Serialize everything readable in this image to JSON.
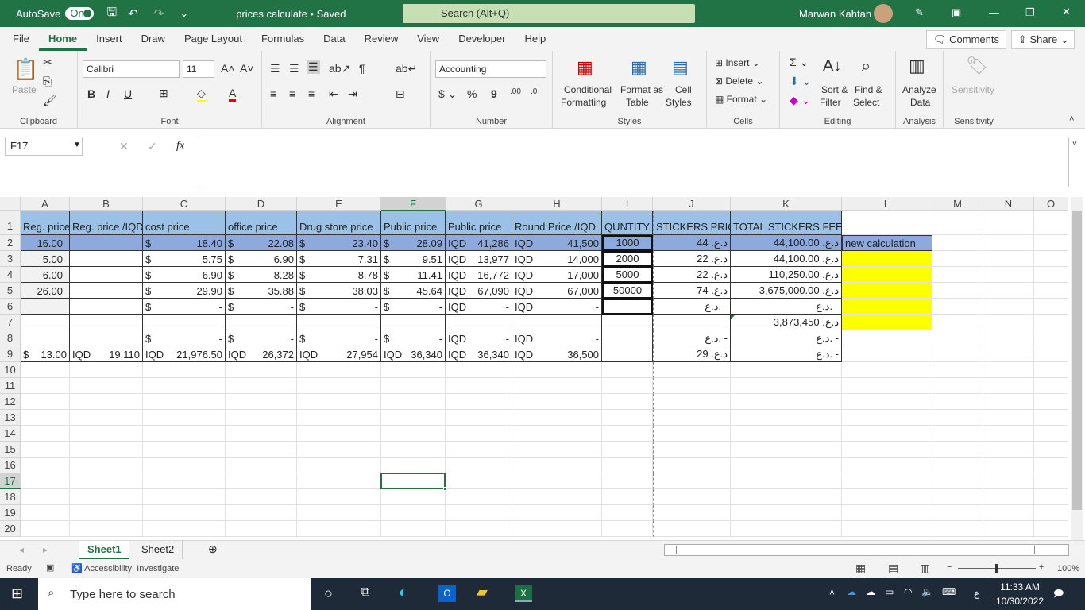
{
  "titlebar": {
    "autosave": "AutoSave",
    "toggle": "On",
    "doc_title": "prices calculate • Saved",
    "search": "Search (Alt+Q)",
    "user": "Marwan Kahtan"
  },
  "menu": {
    "tabs": [
      "File",
      "Home",
      "Insert",
      "Draw",
      "Page Layout",
      "Formulas",
      "Data",
      "Review",
      "View",
      "Developer",
      "Help"
    ],
    "active": "Home",
    "comments": "Comments",
    "share": "Share"
  },
  "ribbon": {
    "clipboard": {
      "label": "Clipboard",
      "paste": "Paste"
    },
    "font": {
      "label": "Font",
      "name": "Calibri",
      "size": "11"
    },
    "alignment": {
      "label": "Alignment"
    },
    "number": {
      "label": "Number",
      "format": "Accounting"
    },
    "styles": {
      "label": "Styles",
      "conditional": "Conditional",
      "formatting": "Formatting",
      "format_as": "Format as",
      "table": "Table",
      "cell": "Cell",
      "cell_styles": "Styles"
    },
    "cells": {
      "label": "Cells",
      "insert": "Insert",
      "delete": "Delete",
      "format": "Format"
    },
    "editing": {
      "label": "Editing",
      "sort": "Sort &",
      "filter": "Filter",
      "find": "Find &",
      "select": "Select"
    },
    "analysis": {
      "label": "Analysis",
      "analyze": "Analyze",
      "data": "Data"
    },
    "sensitivity": {
      "label": "Sensitivity",
      "btn": "Sensitivity"
    }
  },
  "formula_bar": {
    "name_box": "F17",
    "fx": "fx",
    "formula": ""
  },
  "sheet": {
    "columns": [
      "A",
      "B",
      "C",
      "D",
      "E",
      "F",
      "G",
      "H",
      "I",
      "J",
      "K",
      "L",
      "M",
      "N",
      "O"
    ],
    "selected_col": "F",
    "selected_row": 17,
    "row_count": 20,
    "rows": [
      [
        "Reg. price",
        "Reg. price /IQD",
        "cost price",
        "office price",
        "Drug store price",
        "Public price",
        "Public price",
        "Round Price /IQD",
        "QUNTITY",
        "STICKERS PRICE",
        "TOTAL STICKERS FEES",
        ""
      ],
      [
        "16.00",
        "",
        [
          "$",
          "18.40"
        ],
        [
          "$",
          "22.08"
        ],
        [
          "$",
          "23.40"
        ],
        [
          "$",
          "28.09"
        ],
        [
          "IQD",
          "41,286"
        ],
        [
          "IQD",
          "41,500"
        ],
        "1000",
        [
          "",
          "د.ع. 44"
        ],
        [
          "",
          "د.ع. 44,100.00"
        ],
        "new calculation"
      ],
      [
        "5.00",
        "",
        [
          "$",
          "5.75"
        ],
        [
          "$",
          "6.90"
        ],
        [
          "$",
          "7.31"
        ],
        [
          "$",
          "9.51"
        ],
        [
          "IQD",
          "13,977"
        ],
        [
          "IQD",
          "14,000"
        ],
        "2000",
        [
          "",
          "د.ع. 22"
        ],
        [
          "",
          "د.ع. 44,100.00"
        ],
        ""
      ],
      [
        "6.00",
        "",
        [
          "$",
          "6.90"
        ],
        [
          "$",
          "8.28"
        ],
        [
          "$",
          "8.78"
        ],
        [
          "$",
          "11.41"
        ],
        [
          "IQD",
          "16,772"
        ],
        [
          "IQD",
          "17,000"
        ],
        "5000",
        [
          "",
          "د.ع. 22"
        ],
        [
          "",
          "د.ع. 110,250.00"
        ],
        ""
      ],
      [
        "26.00",
        "",
        [
          "$",
          "29.90"
        ],
        [
          "$",
          "35.88"
        ],
        [
          "$",
          "38.03"
        ],
        [
          "$",
          "45.64"
        ],
        [
          "IQD",
          "67,090"
        ],
        [
          "IQD",
          "67,000"
        ],
        "50000",
        [
          "",
          "د.ع. 74"
        ],
        [
          "",
          "د.ع. 3,675,000.00"
        ],
        ""
      ],
      [
        "",
        "",
        [
          "$",
          "-"
        ],
        [
          "$",
          "-"
        ],
        [
          "$",
          "-"
        ],
        [
          "$",
          "-"
        ],
        [
          "IQD",
          "-"
        ],
        [
          "IQD",
          "-"
        ],
        "",
        [
          "",
          "د.ع. -"
        ],
        [
          "",
          "د.ع. -"
        ],
        ""
      ],
      [
        "",
        "",
        "",
        "",
        "",
        "",
        "",
        "",
        "",
        "",
        [
          "",
          "د.ع. 3,873,450"
        ],
        ""
      ],
      [
        "",
        "",
        [
          "$",
          "-"
        ],
        [
          "$",
          "-"
        ],
        [
          "$",
          "-"
        ],
        [
          "$",
          "-"
        ],
        [
          "IQD",
          "-"
        ],
        [
          "IQD",
          "-"
        ],
        "",
        [
          "",
          "د.ع. -"
        ],
        [
          "",
          "د.ع. -"
        ],
        ""
      ],
      [
        [
          "$",
          "13.00"
        ],
        [
          "IQD",
          "19,110"
        ],
        [
          "IQD",
          "21,976.50"
        ],
        [
          "IQD",
          "26,372"
        ],
        [
          "IQD",
          "27,954"
        ],
        [
          "IQD",
          "36,340"
        ],
        [
          "IQD",
          "36,340"
        ],
        [
          "IQD",
          "36,500"
        ],
        "",
        [
          "",
          "د.ع. 29"
        ],
        [
          "",
          "د.ع. -"
        ],
        ""
      ]
    ],
    "colors": {
      "header_fill": "#9BC2E6",
      "row2_fill": "#8EA9DB",
      "highlight": "#FFFF00",
      "accent": "#217346"
    }
  },
  "sheets": {
    "tabs": [
      "Sheet1",
      "Sheet2"
    ],
    "active": "Sheet1"
  },
  "status": {
    "ready": "Ready",
    "accessibility": "Accessibility: Investigate",
    "zoom": "100%"
  },
  "taskbar": {
    "search": "Type here to search",
    "time": "11:33 AM",
    "date": "10/30/2022",
    "lang": "ع"
  }
}
